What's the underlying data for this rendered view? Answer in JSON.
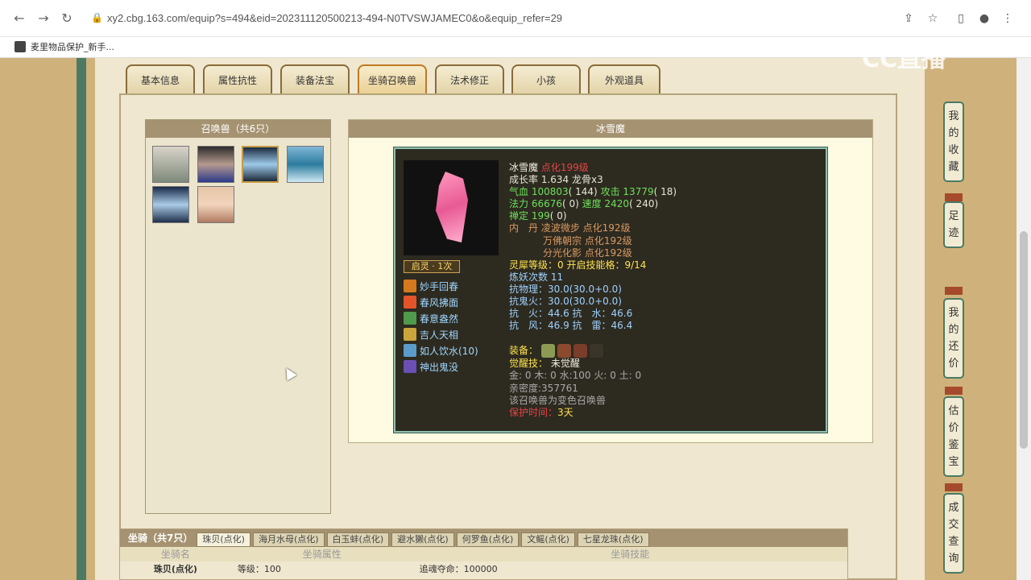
{
  "browser": {
    "url": "xy2.cbg.163.com/equip?s=494&eid=202311120500213-494-N0TVSWJAMEC0&o&equip_refer=29",
    "bookmark": "麦里物品保护_新手..."
  },
  "watermark": "CC直播",
  "tabs": [
    "基本信息",
    "属性抗性",
    "装备法宝",
    "坐骑召唤兽",
    "法术修正",
    "小孩",
    "外观道具"
  ],
  "active_tab": "坐骑召唤兽",
  "summons": {
    "title": "召唤兽（共6只）"
  },
  "detail": {
    "title": "冰雪魔",
    "name": "冰雪魔",
    "level_tag": "点化199级",
    "growth": "成长率 1.634 龙骨x3",
    "hp_label": "气血",
    "hp": "100803",
    "hp_extra": "( 144)",
    "atk_label": "攻击",
    "atk": "13779",
    "atk_extra": "( 18)",
    "mp_label": "法力",
    "mp": "66676",
    "mp_extra": "( 0)",
    "spd_label": "速度",
    "spd": "2420",
    "spd_extra": "( 240)",
    "focus_label": "禅定",
    "focus": "199",
    "focus_extra": "( 0)",
    "neidan_label": "内　丹",
    "neidan": [
      "凌波微步 点化192级",
      "万佛朝宗 点化192级",
      "分光化影 点化192级"
    ],
    "spirit": "灵犀等级：0 开启技能格：9/14",
    "refine": "炼妖次数 11",
    "res_phys": "抗物理：30.0(30.0+0.0)",
    "res_ghost": "抗鬼火：30.0(30.0+0.0)",
    "res_fire_water": "抗　火：44.6 抗　水：46.6",
    "res_wind_thunder": "抗　风：46.9 抗　雷：46.4",
    "equip_label": "装备：",
    "awake_label": "觉醒技：",
    "awake": "未觉醒",
    "elements": "金: 0 木: 0 水:100 火: 0 土: 0",
    "intimacy": "亲密度:357761",
    "transform": "该召唤兽为变色召唤兽",
    "protect_label": "保护时间：",
    "protect": "3天",
    "qiling": "启灵 · 1次",
    "skills": [
      "妙手回春",
      "春风拂面",
      "春意盎然",
      "吉人天相",
      "如人饮水(10)",
      "神出鬼没"
    ]
  },
  "mounts": {
    "title": "坐骑（共7只）",
    "tabs": [
      "珠贝(点化)",
      "海月水母(点化)",
      "白玉蚌(点化)",
      "避水獭(点化)",
      "何罗鱼(点化)",
      "文鳐(点化)",
      "七星龙珠(点化)"
    ],
    "columns": [
      "坐骑名",
      "坐骑属性",
      "坐骑技能"
    ],
    "row": {
      "name": "珠贝(点化)",
      "attr": "等级：100",
      "skill": "追魂夺命：100000"
    }
  },
  "rail": [
    "我的收藏",
    "足迹",
    "我的还价",
    "估价鉴宝",
    "成交查询"
  ]
}
